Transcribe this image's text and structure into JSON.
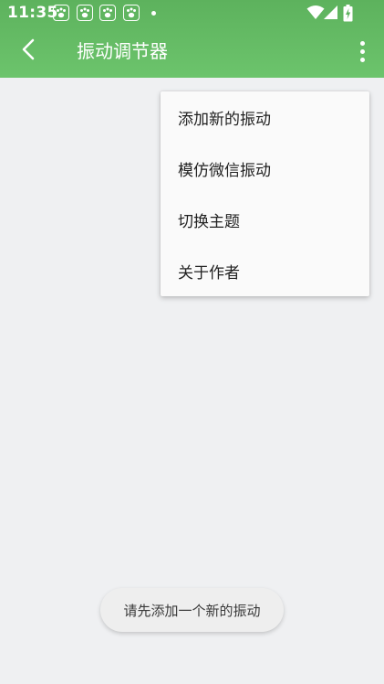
{
  "status_bar": {
    "time": "11:35",
    "notification_icons": [
      "paw-icon",
      "paw-icon",
      "paw-icon",
      "paw-icon"
    ],
    "system_icons": [
      "wifi-icon",
      "signal-icon",
      "battery-charging-icon"
    ]
  },
  "toolbar": {
    "title": "振动调节器",
    "back_icon": "back-arrow-icon",
    "overflow_icon": "more-vert-icon"
  },
  "menu": {
    "items": [
      {
        "label": "添加新的振动"
      },
      {
        "label": "模仿微信振动"
      },
      {
        "label": "切换主题"
      },
      {
        "label": "关于作者"
      }
    ]
  },
  "toast": {
    "message": "请先添加一个新的振动"
  },
  "colors": {
    "toolbar_green": "#5db25d",
    "background": "#eff0f2",
    "menu_background": "#fafafa"
  }
}
